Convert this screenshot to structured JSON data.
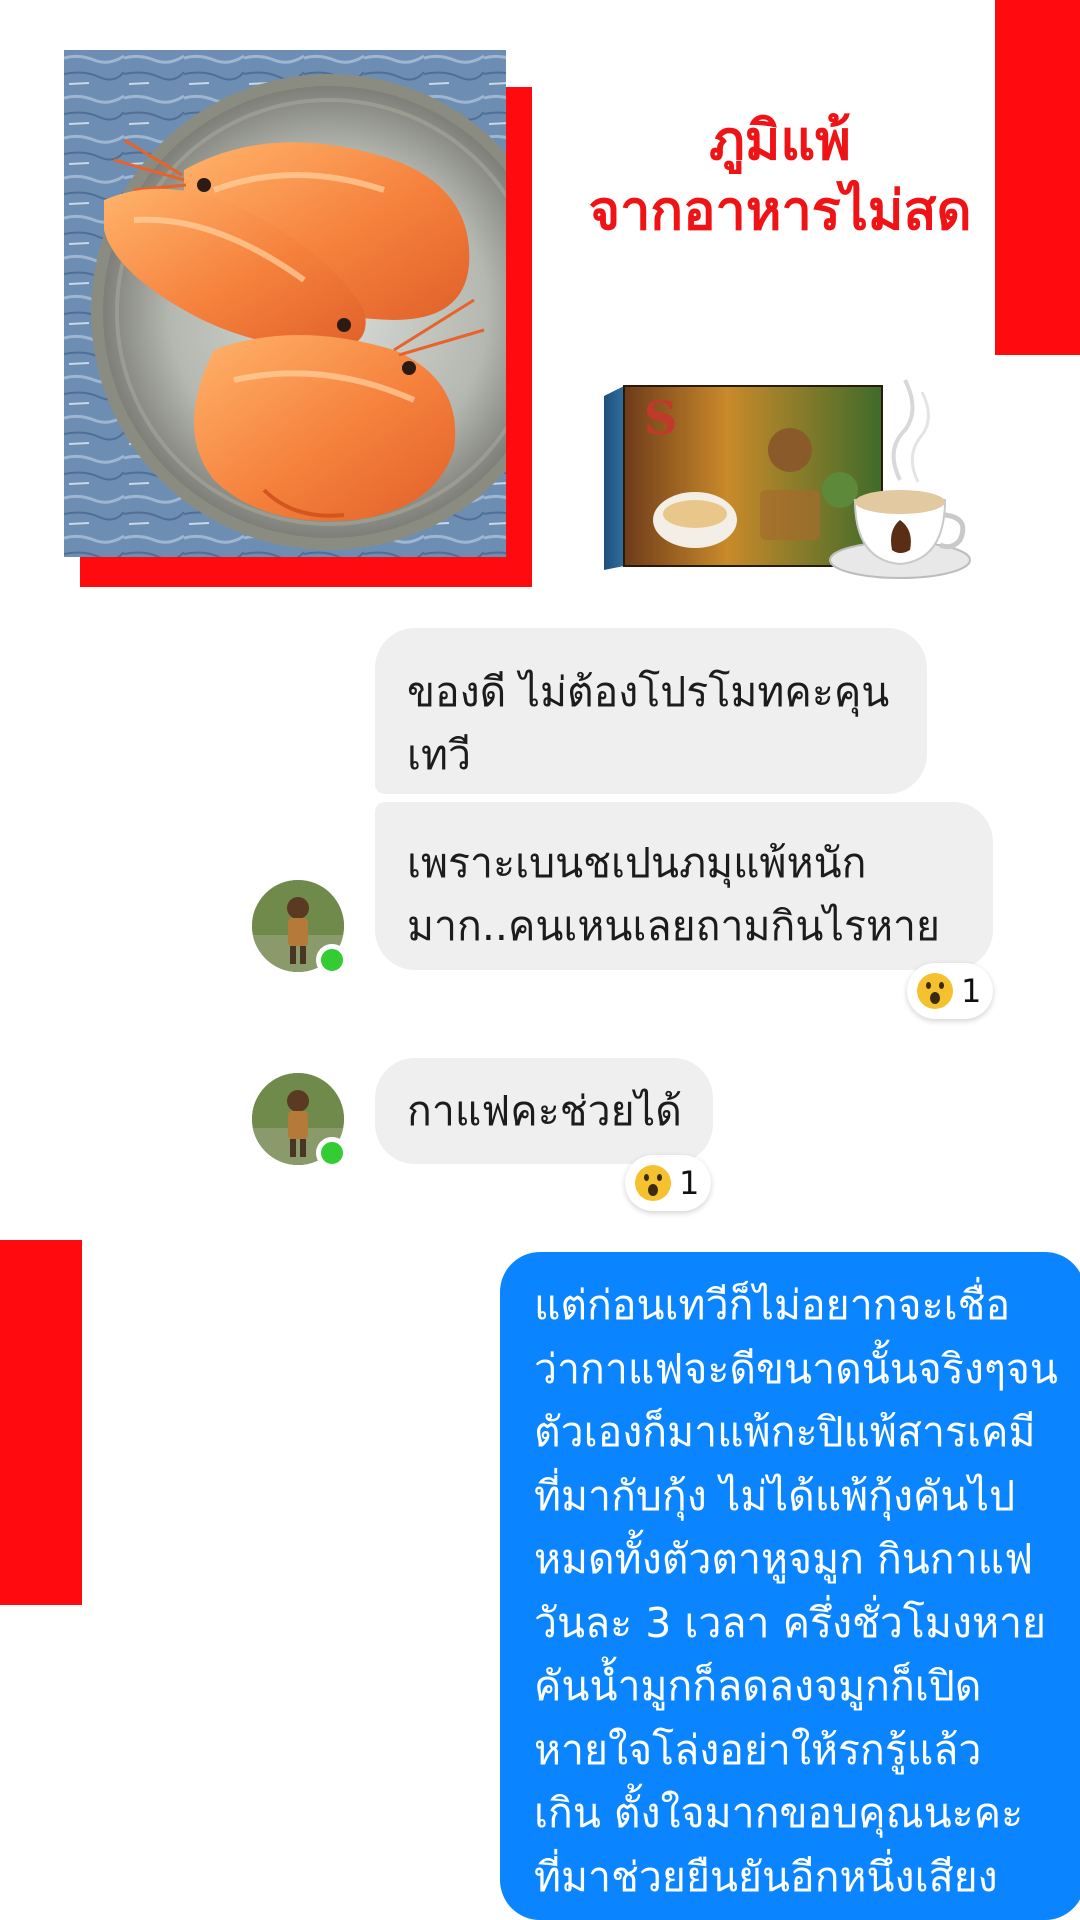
{
  "headline": {
    "line1": "ภูมิแพ้",
    "line2": "จากอาหารไม่สด"
  },
  "colors": {
    "accent_red": "#ff0a0f",
    "headline_red": "#ef1316",
    "outgoing_bubble": "#0a84ff",
    "incoming_bubble": "#efefef",
    "online_dot": "#33cc33"
  },
  "images": {
    "photo": "shrimp-plate-photo",
    "product": "coffee-product-box-and-cup"
  },
  "chat": {
    "messages": [
      {
        "direction": "incoming",
        "lines": [
          "ของดี ไม่ต้องโปรโมทคะคุน",
          "เทวี"
        ]
      },
      {
        "direction": "incoming",
        "lines": [
          "เพราะเบนชเปนภมุแพ้หนัก",
          "มาก..คนเหนเลยถามกินไรหาย"
        ],
        "reaction": {
          "icon": "wow-emoji-icon",
          "count": "1"
        }
      },
      {
        "direction": "incoming",
        "lines": [
          "กาแฟคะช่วยได้"
        ],
        "reaction": {
          "icon": "wow-emoji-icon",
          "count": "1"
        }
      },
      {
        "direction": "outgoing",
        "lines": [
          "แต่ก่อนเทวีก็ไม่อยากจะเชื่อ",
          "ว่ากาแฟจะดีขนาดนั้นจริงๆจน",
          "ตัวเองก็มาแพ้กะปิแพ้สารเคมี",
          "ที่มากับกุ้ง ไม่ได้แพ้กุ้งคันไป",
          "หมดทั้งตัวตาหูจมูก กินกาแฟ",
          "วันละ 3 เวลา ครึ่งชั่วโมงหาย",
          "คันน้ำมูกก็ลดลงจมูกก็เปิด",
          "หายใจโล่งอย่าให้รกรู้แล้ว",
          "เกิน ตั้งใจมากขอบคุณนะคะ",
          "ที่มาช่วยยืนยันอีกหนึ่งเสียง"
        ]
      }
    ]
  }
}
